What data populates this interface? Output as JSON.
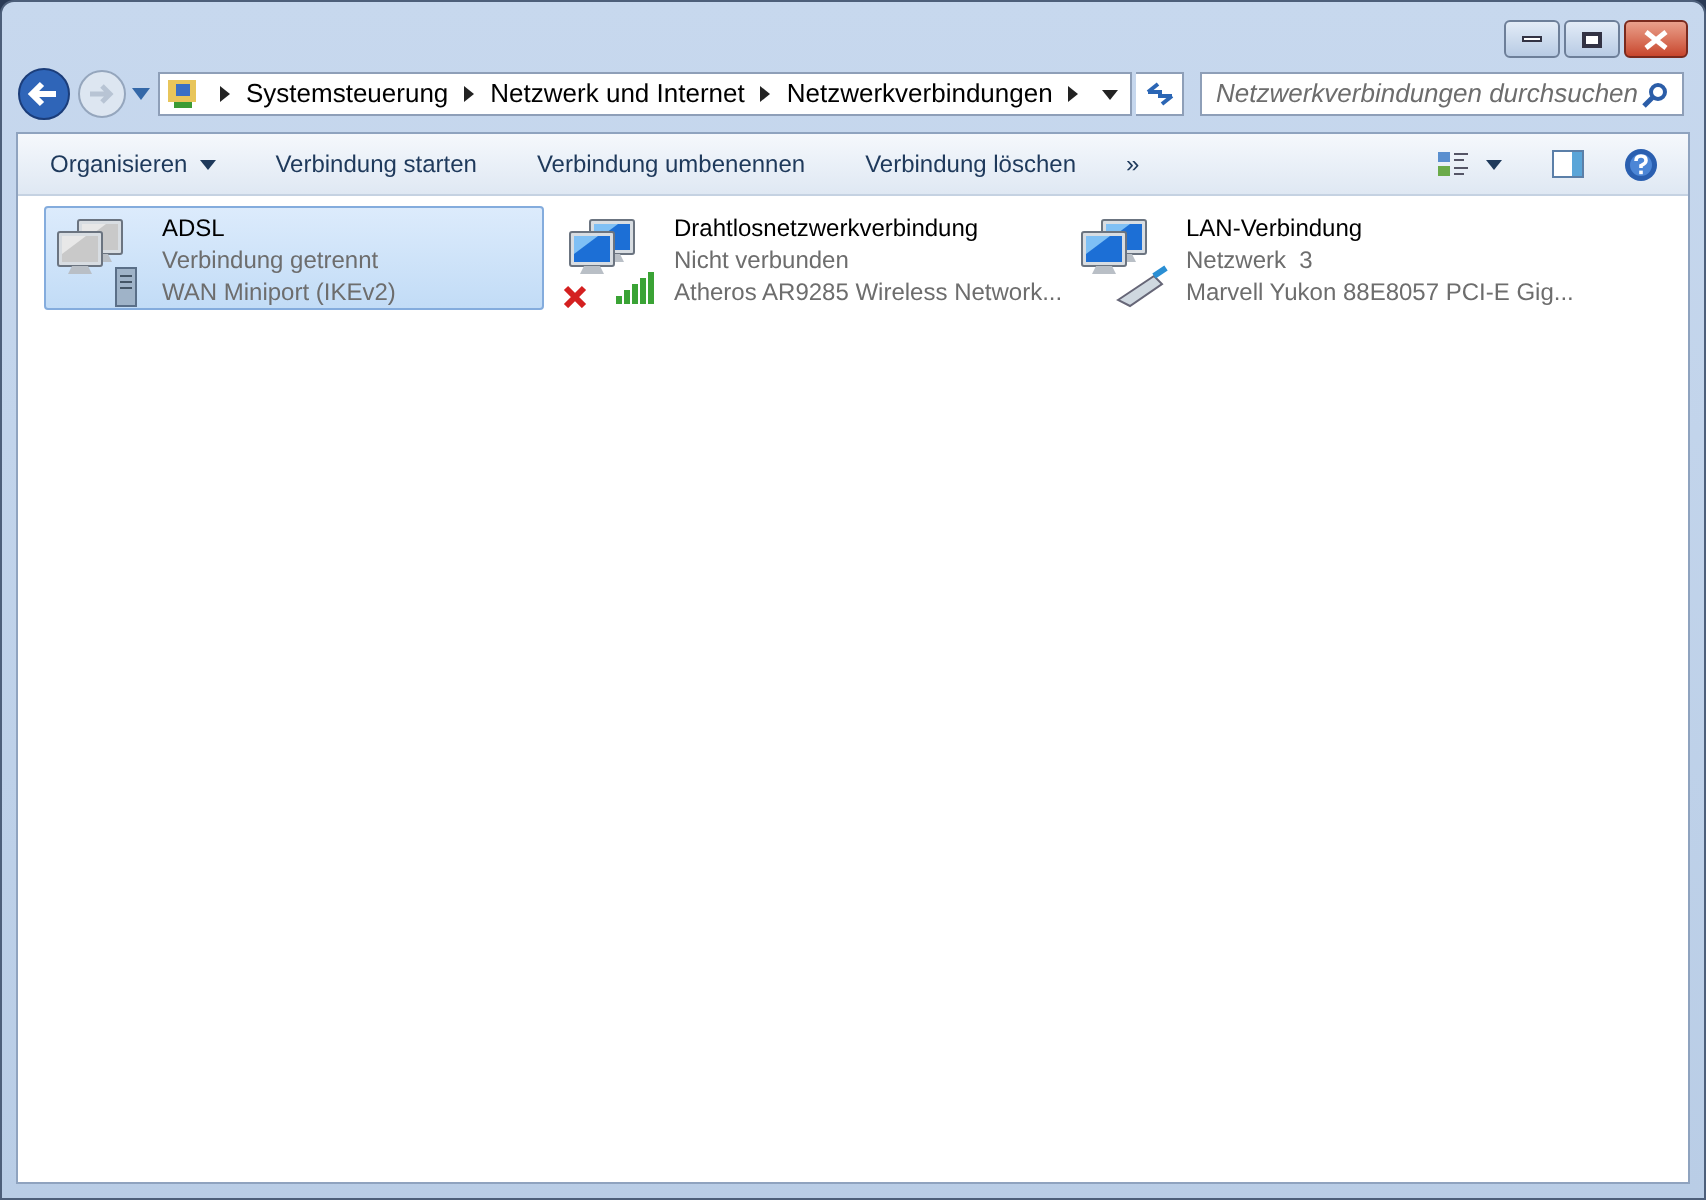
{
  "breadcrumb": [
    "Systemsteuerung",
    "Netzwerk und Internet",
    "Netzwerkverbindungen"
  ],
  "search": {
    "placeholder": "Netzwerkverbindungen durchsuchen"
  },
  "toolbar": [
    {
      "label": "Organisieren",
      "dropdown": true
    },
    {
      "label": "Verbindung starten",
      "dropdown": false
    },
    {
      "label": "Verbindung umbenennen",
      "dropdown": false
    },
    {
      "label": "Verbindung löschen",
      "dropdown": false
    }
  ],
  "toolbar_more": "»",
  "connections": [
    {
      "name": "ADSL",
      "status": "Verbindung getrennt",
      "device": "WAN Miniport (IKEv2)",
      "kind": "dialup",
      "selected": true
    },
    {
      "name": "Drahtlosnetzwerkverbindung",
      "status": "Nicht verbunden",
      "device": "Atheros AR9285 Wireless Network...",
      "kind": "wireless",
      "selected": false
    },
    {
      "name": "LAN-Verbindung",
      "status": "Netzwerk  3",
      "device": "Marvell Yukon 88E8057 PCI-E Gig...",
      "kind": "lan",
      "selected": false
    }
  ]
}
